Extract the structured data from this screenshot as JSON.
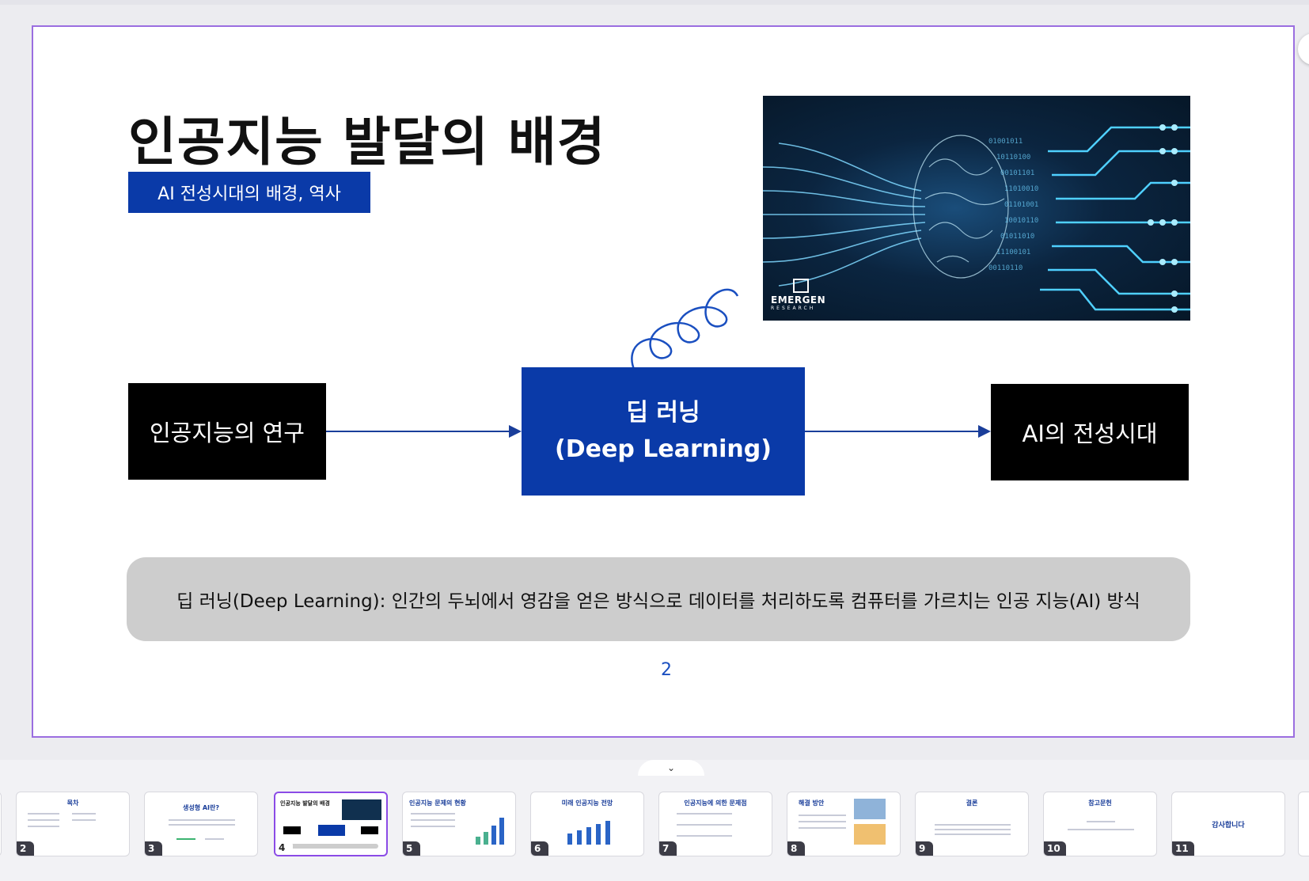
{
  "slide": {
    "title": "인공지능 발달의 배경",
    "subtitle": "AI 전성시대의 배경, 역사",
    "image_logo": "EMERGEN",
    "image_logo_sub": "RESEARCH",
    "box_left": "인공지능의 연구",
    "box_center_line1": "딥 러닝",
    "box_center_line2": "(Deep Learning)",
    "box_right": "AI의 전성시대",
    "definition": "딥 러닝(Deep Learning): 인간의 두뇌에서 영감을 얻은 방식으로 데이터를 처리하도록 컴퓨터를 가르치는 인공 지능(AI) 방식",
    "page_number": "2",
    "accent_color": "#0a3aa8",
    "selection_color": "#9b6ee0"
  },
  "strip": {
    "toggle_icon": "⌄",
    "thumbnails": [
      {
        "num": "2",
        "title": "목차"
      },
      {
        "num": "3",
        "title": "생성형 AI란?"
      },
      {
        "num": "4",
        "title": "인공지능 발달의 배경"
      },
      {
        "num": "5",
        "title": "인공지능 문제의 현황"
      },
      {
        "num": "6",
        "title": "미래 인공지능 전망"
      },
      {
        "num": "7",
        "title": "인공지능에 의한 문제점"
      },
      {
        "num": "8",
        "title": "해결 방안"
      },
      {
        "num": "9",
        "title": "결론"
      },
      {
        "num": "10",
        "title": "참고문헌"
      },
      {
        "num": "11",
        "title": "감사합니다"
      }
    ]
  }
}
